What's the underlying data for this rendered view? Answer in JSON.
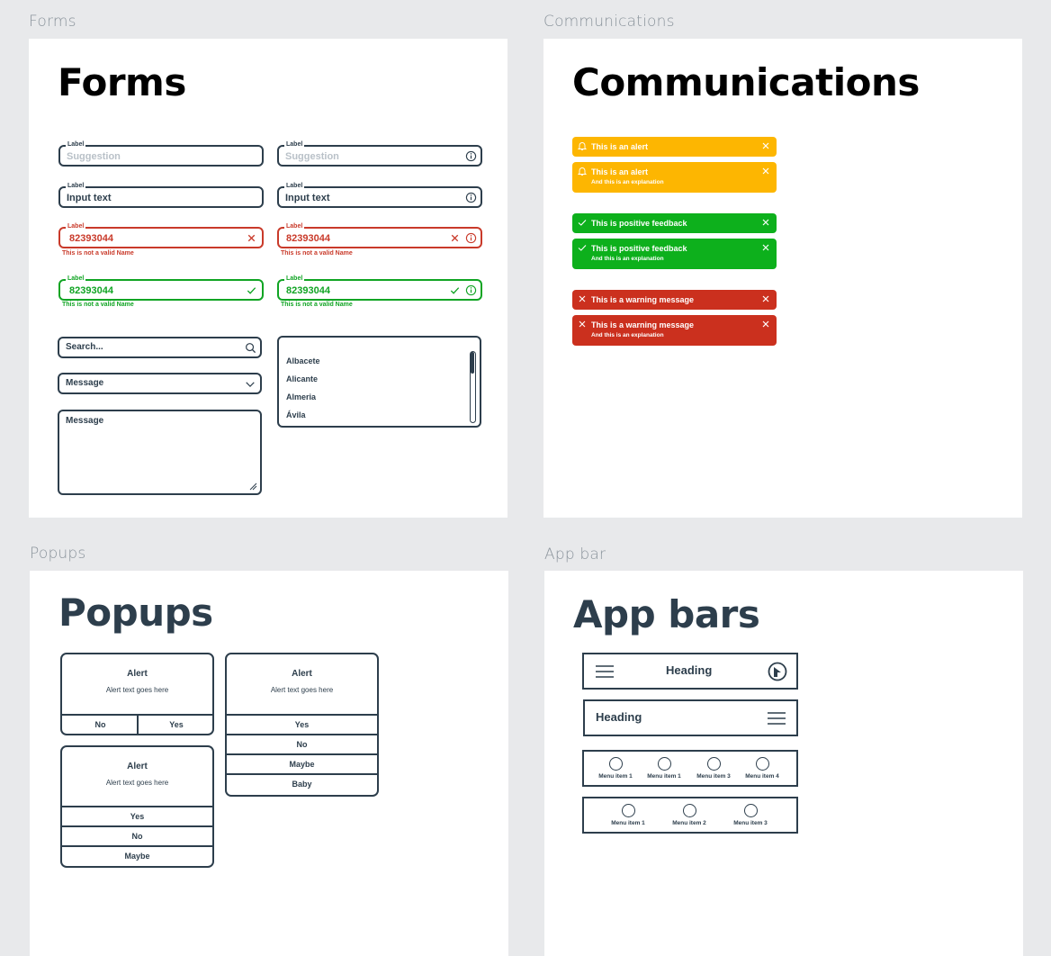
{
  "frames": {
    "forms": {
      "label": "Forms",
      "title": "Forms"
    },
    "communications": {
      "label": "Communications",
      "title": "Communications"
    },
    "popups": {
      "label": "Popups",
      "title": "Popups"
    },
    "appbar": {
      "label": "App bar",
      "title": "App bars"
    }
  },
  "forms": {
    "field_label": "Label",
    "suggestion": "Suggestion",
    "input_text": "Input text",
    "number_value": "82393044",
    "error_hint": "This is not a valid Name",
    "search_placeholder": "Search...",
    "select_value": "Message",
    "textarea_value": "Message",
    "list_items": [
      "Albacete",
      "Alicante",
      "Almeria",
      "Ávila"
    ]
  },
  "communications": {
    "alert_title": "This is an alert",
    "explanation": "And this is an explanation",
    "positive_title": "This is positive feedback",
    "warning_title": "This is a warning message",
    "colors": {
      "alert": "#fdb601",
      "positive": "#0db01c",
      "warning": "#cb301e"
    }
  },
  "popups": {
    "title": "Alert",
    "text": "Alert text goes here",
    "options_a": [
      "No",
      "Yes"
    ],
    "options_b": [
      "Yes",
      "No",
      "Maybe",
      "Baby"
    ],
    "options_c": [
      "Yes",
      "No",
      "Maybe"
    ]
  },
  "appbars": {
    "heading": "Heading",
    "menu4": [
      "Menu item 1",
      "Menu item 1",
      "Menu item 3",
      "Menu item 4"
    ],
    "menu3": [
      "Menu item 1",
      "Menu item 2",
      "Menu item 3"
    ]
  },
  "colors": {
    "ink": "#2d3e4c",
    "error": "#c93a2a",
    "success": "#10a423",
    "background": "#e8e9eb"
  }
}
